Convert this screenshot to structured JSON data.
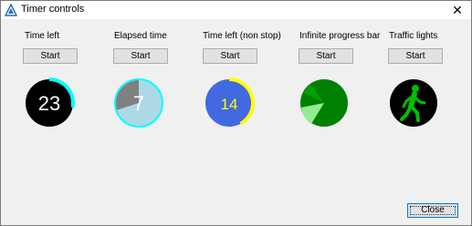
{
  "window": {
    "title": "Timer controls",
    "close_glyph": "✕"
  },
  "widgets": [
    {
      "label": "Time left",
      "button": "Start",
      "value": "23",
      "progress": 0.28,
      "colors": {
        "face": "#000000",
        "ring": "#00ffff",
        "text": "#ffffff"
      }
    },
    {
      "label": "Elapsed time",
      "button": "Start",
      "value": "7",
      "progress": 0.3,
      "colors": {
        "face": "#add8e6",
        "filled": "#808080",
        "ring": "#00ffff",
        "text": "#ffffff"
      }
    },
    {
      "label": "Time left (non stop)",
      "button": "Start",
      "value": "14",
      "progress": 0.42,
      "colors": {
        "face": "#4169e1",
        "ring": "#ffff00",
        "text": "#ffff00"
      }
    },
    {
      "label": "Infinite progress bar",
      "button": "Start",
      "colors": {
        "face": "#008000",
        "segment": "#90ee90"
      }
    },
    {
      "label": "Traffic lights",
      "button": "Start",
      "colors": {
        "face": "#000000",
        "figure": "#00c000"
      },
      "icon": "walking-person-icon"
    }
  ],
  "footer": {
    "close_label": "Close"
  }
}
